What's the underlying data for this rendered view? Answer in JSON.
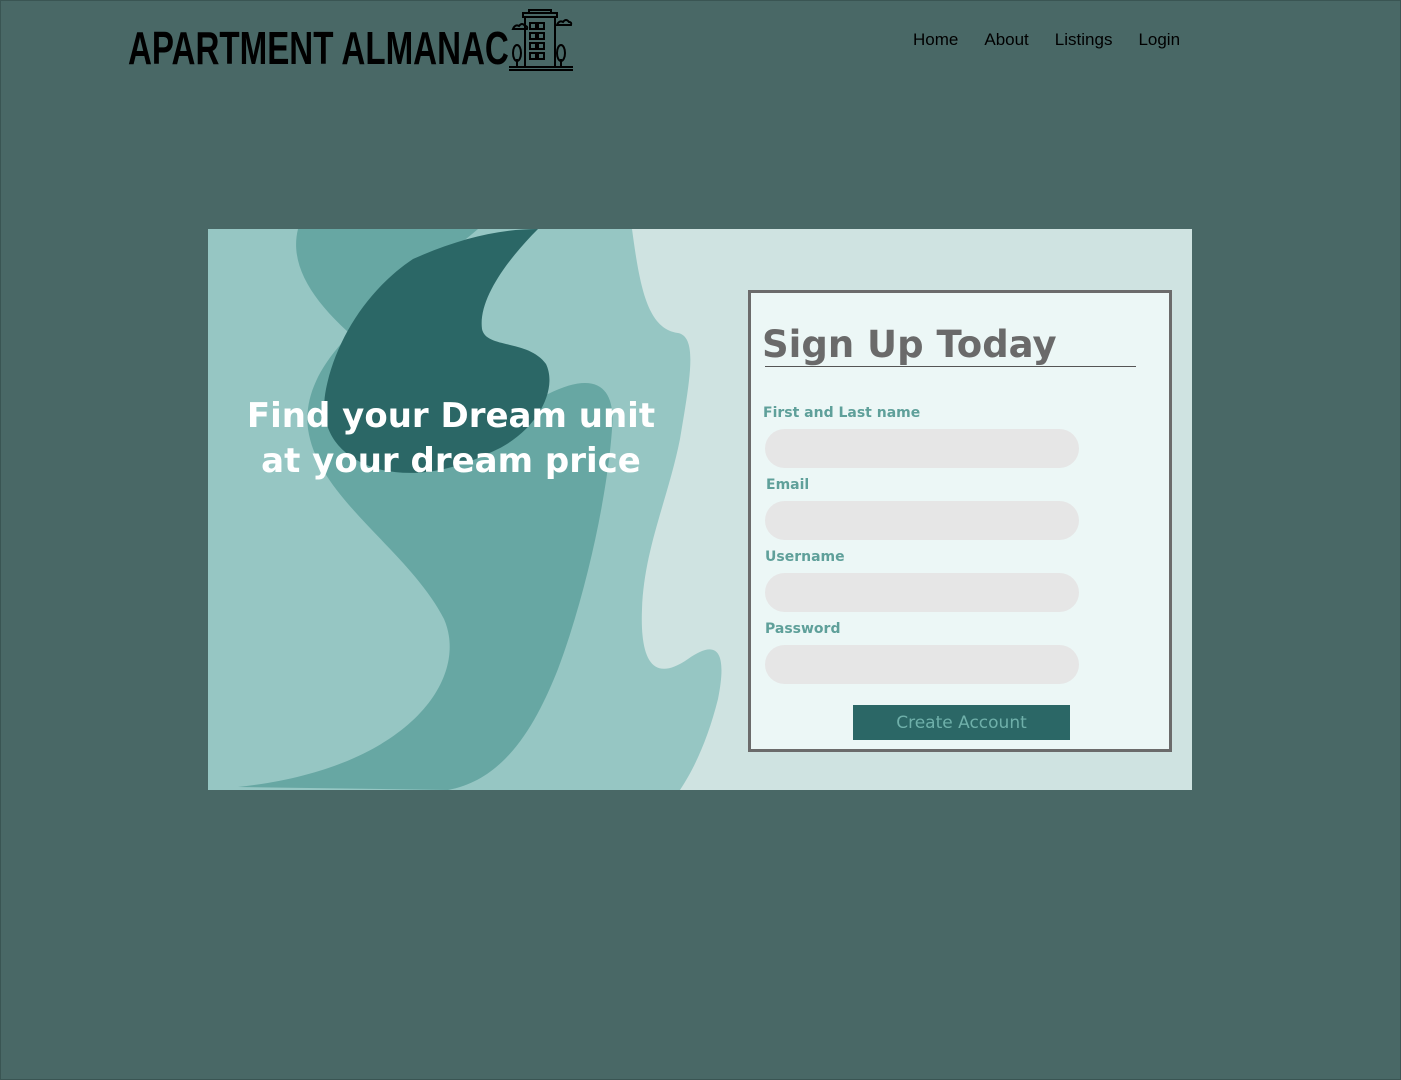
{
  "brand": {
    "name": "APARTMENT ALMANAC",
    "logo_icon": "apartment-building-icon"
  },
  "nav": {
    "items": [
      {
        "label": "Home"
      },
      {
        "label": "About"
      },
      {
        "label": "Listings"
      },
      {
        "label": "Login"
      }
    ]
  },
  "hero": {
    "headline_line1": "Find your Dream unit",
    "headline_line2": "at your dream price"
  },
  "signup": {
    "title": "Sign Up Today",
    "fields": [
      {
        "label": "First and Last name",
        "value": "",
        "placeholder": ""
      },
      {
        "label": "Email",
        "value": "",
        "placeholder": ""
      },
      {
        "label": "Username",
        "value": "",
        "placeholder": ""
      },
      {
        "label": "Password",
        "value": "",
        "placeholder": ""
      }
    ],
    "submit_label": "Create Account"
  },
  "colors": {
    "page_background": "#496866",
    "hero_light": "#cfe3e1",
    "wave_mid": "#96c6c3",
    "wave_medium": "#67a7a3",
    "wave_dark": "#2b6766",
    "form_background": "#ecf7f6",
    "label_accent": "#5fa09a",
    "input_background": "#e6e6e6",
    "button_background": "#2b6766"
  }
}
